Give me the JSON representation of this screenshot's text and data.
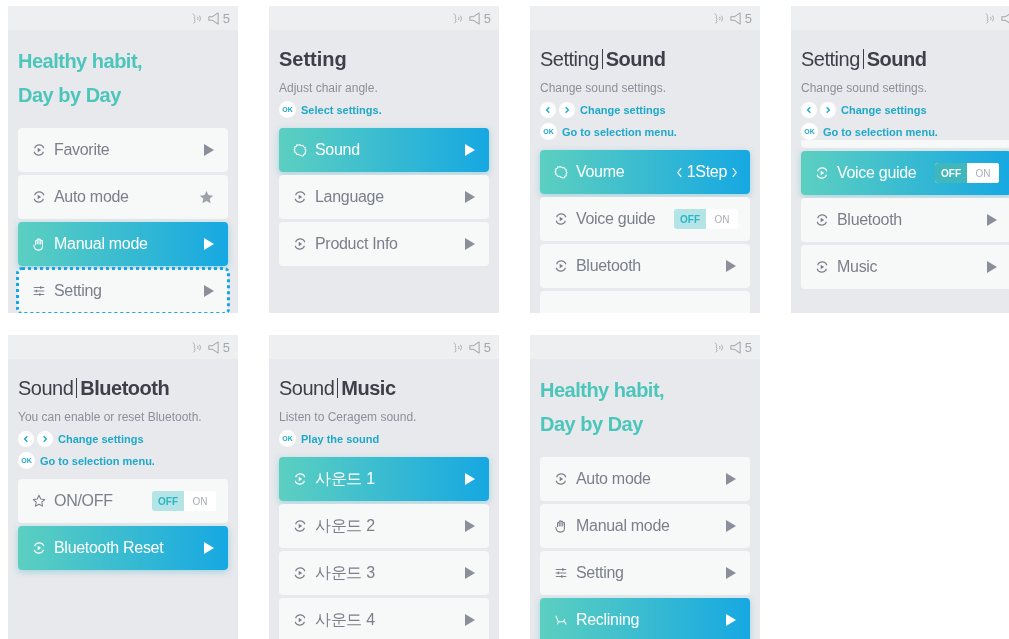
{
  "screens": [
    {
      "volume": "5",
      "title": {
        "kind": "greeting",
        "lines": [
          "Healthy habit,",
          "Day by Day"
        ]
      },
      "items": [
        {
          "kind": "arrow",
          "label": "Favorite",
          "selected": false,
          "focused": false
        },
        {
          "kind": "star",
          "label": "Auto mode",
          "selected": false,
          "focused": false
        },
        {
          "kind": "arrow",
          "label": "Manual mode",
          "selected": true,
          "focused": false
        },
        {
          "kind": "arrow",
          "label": "Setting",
          "selected": false,
          "focused": true
        }
      ]
    },
    {
      "volume": "5",
      "title": {
        "kind": "plain",
        "text": "Setting"
      },
      "description": "Adjust chair angle.",
      "hints": [
        {
          "kind": "ok",
          "key": "OK",
          "text": "Select settings."
        }
      ],
      "items": [
        {
          "kind": "arrow",
          "label": "Sound",
          "selected": true
        },
        {
          "kind": "arrow",
          "label": "Language",
          "selected": false
        },
        {
          "kind": "arrow",
          "label": "Product Info",
          "selected": false
        }
      ]
    },
    {
      "volume": "5",
      "title": {
        "kind": "path",
        "parent": "Setting",
        "current": "Sound"
      },
      "description": "Change sound settings.",
      "hints": [
        {
          "kind": "arrows",
          "text": "Change settings"
        },
        {
          "kind": "ok",
          "key": "OK",
          "text": "Go to selection menu."
        }
      ],
      "items": [
        {
          "kind": "stepper",
          "label": "Voume",
          "value": "1Step",
          "selected": true
        },
        {
          "kind": "toggle",
          "label": "Voice guide",
          "off_label": "OFF",
          "on_label": "ON",
          "on": false,
          "selected": false
        },
        {
          "kind": "arrow",
          "label": "Bluetooth",
          "selected": false
        },
        {
          "kind": "edge"
        }
      ]
    },
    {
      "title": {
        "kind": "path",
        "parent": "Setting",
        "current": "Sound"
      },
      "description": "Change sound settings.",
      "hints": [
        {
          "kind": "arrows",
          "text": "Change settings"
        },
        {
          "kind": "ok",
          "key": "OK",
          "text": "Go to selection menu."
        }
      ],
      "items": [
        {
          "kind": "edge"
        },
        {
          "kind": "toggle",
          "label": "Voice guide",
          "off_label": "OFF",
          "on_label": "ON",
          "on": false,
          "selected": true
        },
        {
          "kind": "arrow",
          "label": "Bluetooth",
          "selected": false
        },
        {
          "kind": "arrow",
          "label": "Music",
          "selected": false
        }
      ]
    },
    {
      "volume": "5",
      "title": {
        "kind": "path",
        "parent": "Sound",
        "current": "Bluetooth"
      },
      "description": "You can enable or reset Bluetooth.",
      "hints": [
        {
          "kind": "arrows",
          "text": "Change settings"
        },
        {
          "kind": "ok",
          "key": "OK",
          "text": "Go to selection menu."
        }
      ],
      "items": [
        {
          "kind": "toggle",
          "label": "ON/OFF",
          "off_label": "OFF",
          "on_label": "ON",
          "on": false,
          "selected": false
        },
        {
          "kind": "arrow",
          "label": "Bluetooth Reset",
          "selected": true
        }
      ]
    },
    {
      "volume": "5",
      "title": {
        "kind": "path",
        "parent": "Sound",
        "current": "Music"
      },
      "description": "Listen to Ceragem sound.",
      "hints": [
        {
          "kind": "ok",
          "key": "OK",
          "text": "Play the sound"
        }
      ],
      "items": [
        {
          "kind": "arrow",
          "label": "사운드 1",
          "selected": true
        },
        {
          "kind": "arrow",
          "label": "사운드 2",
          "selected": false
        },
        {
          "kind": "arrow",
          "label": "사운드 3",
          "selected": false
        },
        {
          "kind": "arrow",
          "label": "사운드 4",
          "selected": false
        }
      ]
    },
    {
      "volume": "5",
      "title": {
        "kind": "greeting",
        "lines": [
          "Healthy habit,",
          "Day by Day"
        ]
      },
      "items": [
        {
          "kind": "arrow",
          "label": "Auto mode",
          "selected": false
        },
        {
          "kind": "arrow",
          "label": "Manual mode",
          "selected": false
        },
        {
          "kind": "arrow",
          "label": "Setting",
          "selected": false
        },
        {
          "kind": "arrow",
          "label": "Reclining",
          "selected": true
        }
      ]
    }
  ]
}
